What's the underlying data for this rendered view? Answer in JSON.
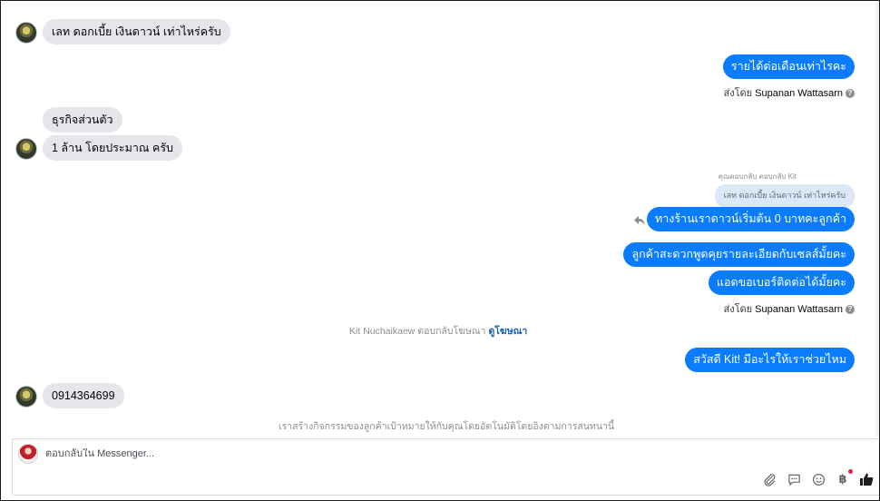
{
  "messages": {
    "m1": {
      "text": "เลท ดอกเบี้ย  เงินดาวน์ เท่าไหร่ครับ"
    },
    "m2": {
      "text": "รายได้ต่อเดือนเท่าไรคะ"
    },
    "sent_by_1": {
      "prefix": "ส่งโดย",
      "name": "Supanan Wattasarn",
      "icon": "info-icon"
    },
    "m3": {
      "text": "ธุรกิจส่วนตัว"
    },
    "m4": {
      "text": "1 ล้าน โดยประมาณ ครับ"
    },
    "reply_meta": "คุณตอบกลับ ตอบกลับ Kit",
    "quoted_text": "เลท ดอกเบี้ย เงินดาวน์ เท่าไหร่ครับ",
    "m5": {
      "text": "ทางร้านเราดาวน์เริ่มต้น 0 บาทคะลูกค้า"
    },
    "m6": {
      "text": "ลูกค้าสะดวกพูดคุยรายละเอียดกับเซลส์มั้ยคะ"
    },
    "m7": {
      "text": "แอดขอเบอร์ติดต่อได้มั้ยคะ"
    },
    "sent_by_2": {
      "prefix": "ส่งโดย",
      "name": "Supanan Wattasarn",
      "icon": "info-icon"
    },
    "ad_notice": {
      "text": "Kit Nuchaikaew ตอบกลับโฆษณา",
      "link": "ดูโฆษณา"
    },
    "m8": {
      "text": "สวัสดี Kit! มีอะไรให้เราช่วยไหม"
    },
    "m9": {
      "text": "0914364699"
    },
    "automation_notice": "เราสร้างกิจกรรมของลูกค้าเป้าหมายให้กับคุณโดยอัตโนมัติโดยอิงตามการสนทนานี้"
  },
  "composer": {
    "placeholder": "ตอบกลับใน Messenger...",
    "tools": [
      "paperclip-icon",
      "saved-reply-icon",
      "emoji-icon",
      "baht-icon",
      "like-icon"
    ]
  },
  "colors": {
    "outgoing": "#0a7cff",
    "incoming": "#e4e6eb",
    "quoted": "#dbe8f8",
    "link": "#1a5fb4",
    "badge": "#e41e3f"
  }
}
